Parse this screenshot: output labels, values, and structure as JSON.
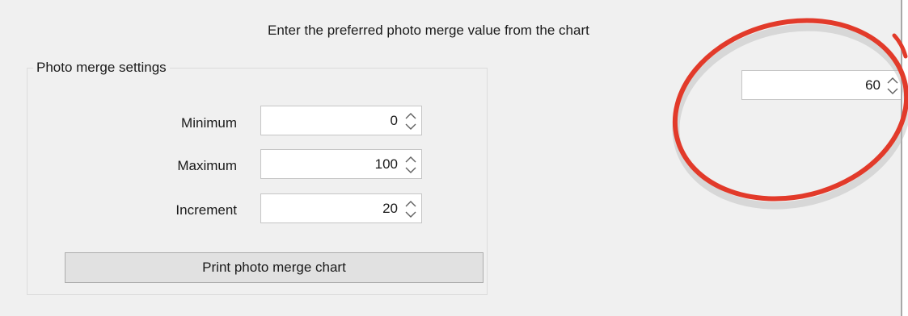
{
  "instruction_text": "Enter the preferred photo merge value from the chart",
  "group": {
    "title": "Photo merge settings",
    "fields": [
      {
        "label": "Minimum",
        "value": "0"
      },
      {
        "label": "Maximum",
        "value": "100"
      },
      {
        "label": "Increment",
        "value": "20"
      }
    ],
    "print_button_label": "Print photo merge chart"
  },
  "preferred_value": "60",
  "icons": {
    "spin_up": "chevron-up-icon",
    "spin_down": "chevron-down-icon"
  },
  "colors": {
    "window_background": "#f0f0f0",
    "annotation_circle": "#e23a2a",
    "button_background": "#e1e1e1"
  }
}
